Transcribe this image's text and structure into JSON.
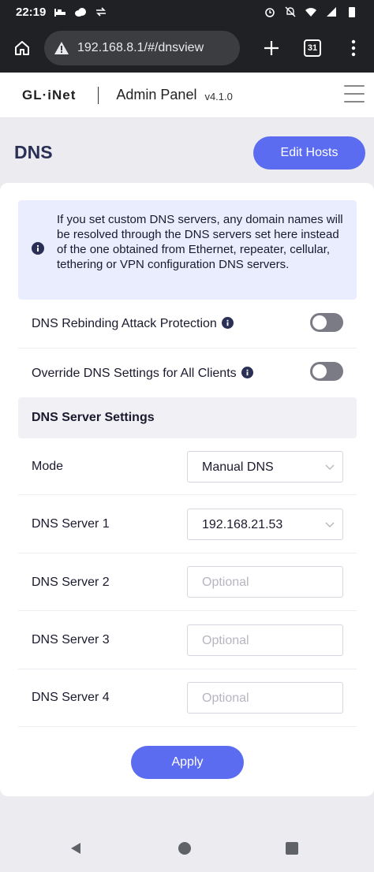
{
  "status_bar": {
    "time": "22:19",
    "left_icons": [
      "bed-icon",
      "cloud-icon",
      "data-transfer-icon"
    ],
    "right_icons": [
      "alarm-icon",
      "notifications-off-icon",
      "wifi-icon",
      "signal-icon",
      "battery-icon"
    ]
  },
  "browser": {
    "url": "192.168.8.1/#/dnsview",
    "tab_count": "31",
    "icons": [
      "home-icon",
      "warning-icon",
      "new-tab-icon",
      "tabs-icon",
      "more-icon"
    ]
  },
  "header": {
    "logo": "GL·iNet",
    "title": "Admin Panel",
    "version": "v4.1.0"
  },
  "page": {
    "title": "DNS",
    "edit_hosts_label": "Edit Hosts"
  },
  "notice": {
    "text": "If you set custom DNS servers, any domain names will be resolved through the DNS servers set here instead of the one obtained from Ethernet, repeater, cellular, tethering or VPN configuration DNS servers."
  },
  "toggles": [
    {
      "label": "DNS Rebinding Attack Protection",
      "on": false
    },
    {
      "label": "Override DNS Settings for All Clients",
      "on": false
    }
  ],
  "server_settings": {
    "heading": "DNS Server Settings",
    "mode": {
      "label": "Mode",
      "value": "Manual DNS"
    },
    "server1": {
      "label": "DNS Server 1",
      "value": "192.168.21.53"
    },
    "server2": {
      "label": "DNS Server 2",
      "placeholder": "Optional"
    },
    "server3": {
      "label": "DNS Server 3",
      "placeholder": "Optional"
    },
    "server4": {
      "label": "DNS Server 4",
      "placeholder": "Optional"
    }
  },
  "apply_label": "Apply",
  "colors": {
    "accent": "#5b6cf0",
    "notice_bg": "#eaedfd",
    "title_color": "#2a2f55"
  }
}
